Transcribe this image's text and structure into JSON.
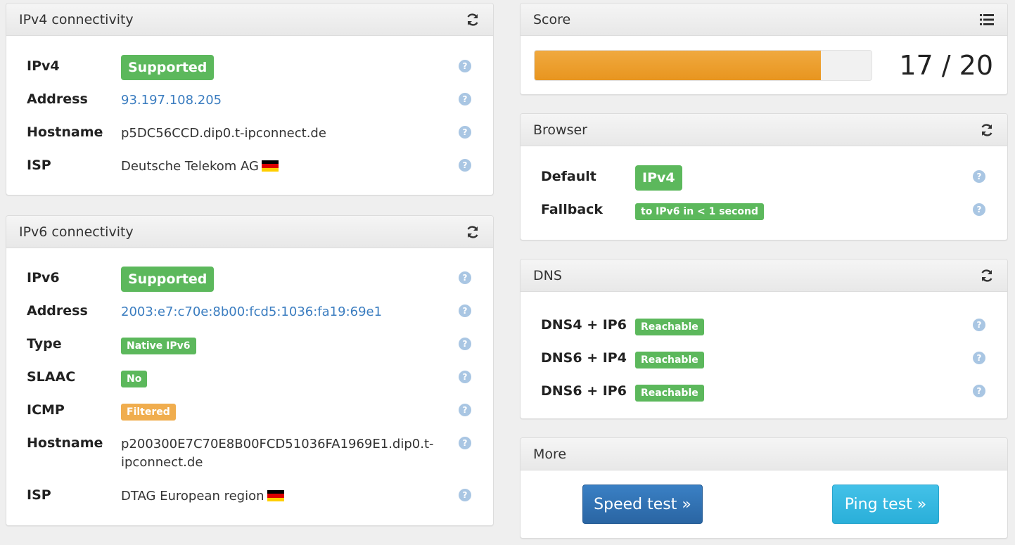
{
  "ipv4_panel": {
    "title": "IPv4 connectivity",
    "rows": [
      {
        "label": "IPv4",
        "badge": "Supported"
      },
      {
        "label": "Address",
        "value": "93.197.108.205"
      },
      {
        "label": "Hostname",
        "value": "p5DC56CCD.dip0.t-ipconnect.de"
      },
      {
        "label": "ISP",
        "value": "Deutsche Telekom AG"
      }
    ]
  },
  "ipv6_panel": {
    "title": "IPv6 connectivity",
    "rows": [
      {
        "label": "IPv6",
        "badge": "Supported"
      },
      {
        "label": "Address",
        "value": "2003:e7:c70e:8b00:fcd5:1036:fa19:69e1"
      },
      {
        "label": "Type",
        "badge": "Native IPv6"
      },
      {
        "label": "SLAAC",
        "badge": "No"
      },
      {
        "label": "ICMP",
        "badge": "Filtered"
      },
      {
        "label": "Hostname",
        "value_line1": "p200300E7C70E8B00FCD51036FA1969E1.dip0.t-",
        "value_line2": "ipconnect.de"
      },
      {
        "label": "ISP",
        "value": "DTAG European region"
      }
    ]
  },
  "score_panel": {
    "title": "Score",
    "score_text": "17 / 20",
    "score_fraction": 0.85
  },
  "browser_panel": {
    "title": "Browser",
    "rows": [
      {
        "label": "Default",
        "badge": "IPv4"
      },
      {
        "label": "Fallback",
        "badge": "to IPv6 in < 1 second"
      }
    ]
  },
  "dns_panel": {
    "title": "DNS",
    "rows": [
      {
        "label": "DNS4 + IP6",
        "badge": "Reachable"
      },
      {
        "label": "DNS6 + IP4",
        "badge": "Reachable"
      },
      {
        "label": "DNS6 + IP6",
        "badge": "Reachable"
      }
    ]
  },
  "more_panel": {
    "title": "More",
    "speed_test": "Speed test »",
    "ping_test": "Ping test »"
  },
  "help_glyph": "?",
  "icons": [
    "refresh-icon",
    "list-icon",
    "help-icon",
    "flag-de-icon"
  ],
  "colors": {
    "success": "#5cb85c",
    "warning": "#f0ad4e",
    "progress": "#ec9b2a",
    "link": "#3b7dc0",
    "primary": "#2f6fb0",
    "info": "#2fb4de"
  }
}
